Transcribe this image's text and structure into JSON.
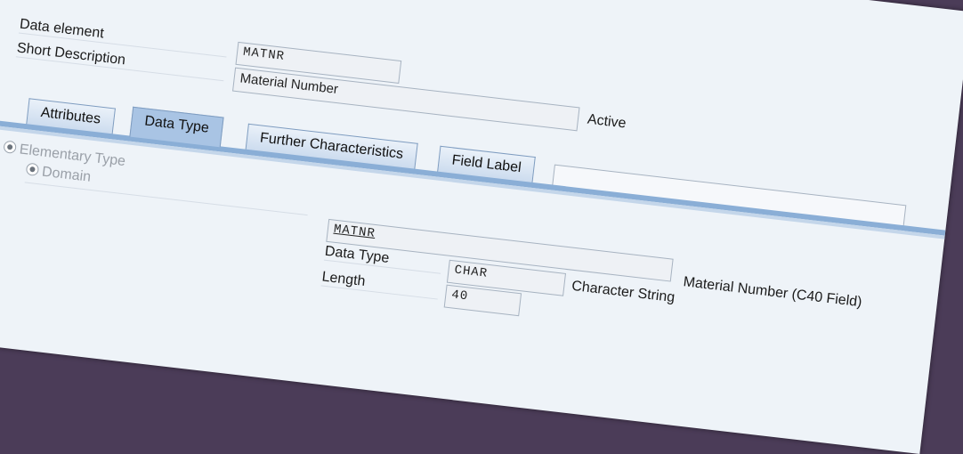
{
  "header": {
    "data_element_label": "Data element",
    "data_element_value": "MATNR",
    "short_description_label": "Short Description",
    "short_description_value": "Material Number",
    "status": "Active"
  },
  "tabs": [
    {
      "label": "Attributes",
      "active": false
    },
    {
      "label": "Data Type",
      "active": true
    },
    {
      "label": "Further Characteristics",
      "active": false
    },
    {
      "label": "Field Label",
      "active": false
    }
  ],
  "type_section": {
    "elementary_type_label": "Elementary Type",
    "domain_label": "Domain",
    "domain_value": "MATNR",
    "domain_description": "Material Number (C40 Field)",
    "data_type_label": "Data Type",
    "data_type_value": "CHAR",
    "data_type_description": "Character String",
    "length_label": "Length",
    "length_value": "40"
  }
}
